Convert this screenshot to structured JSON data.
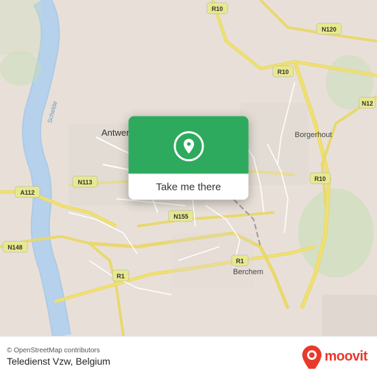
{
  "map": {
    "attribution": "© OpenStreetMap contributors",
    "background_color": "#e8e0d8"
  },
  "popup": {
    "button_label": "Take me there",
    "icon_name": "location-pin-icon"
  },
  "bottom_bar": {
    "location_name": "Teledienst Vzw, Belgium",
    "osm_text": "© OpenStreetMap contributors",
    "moovit_text": "moovit"
  }
}
